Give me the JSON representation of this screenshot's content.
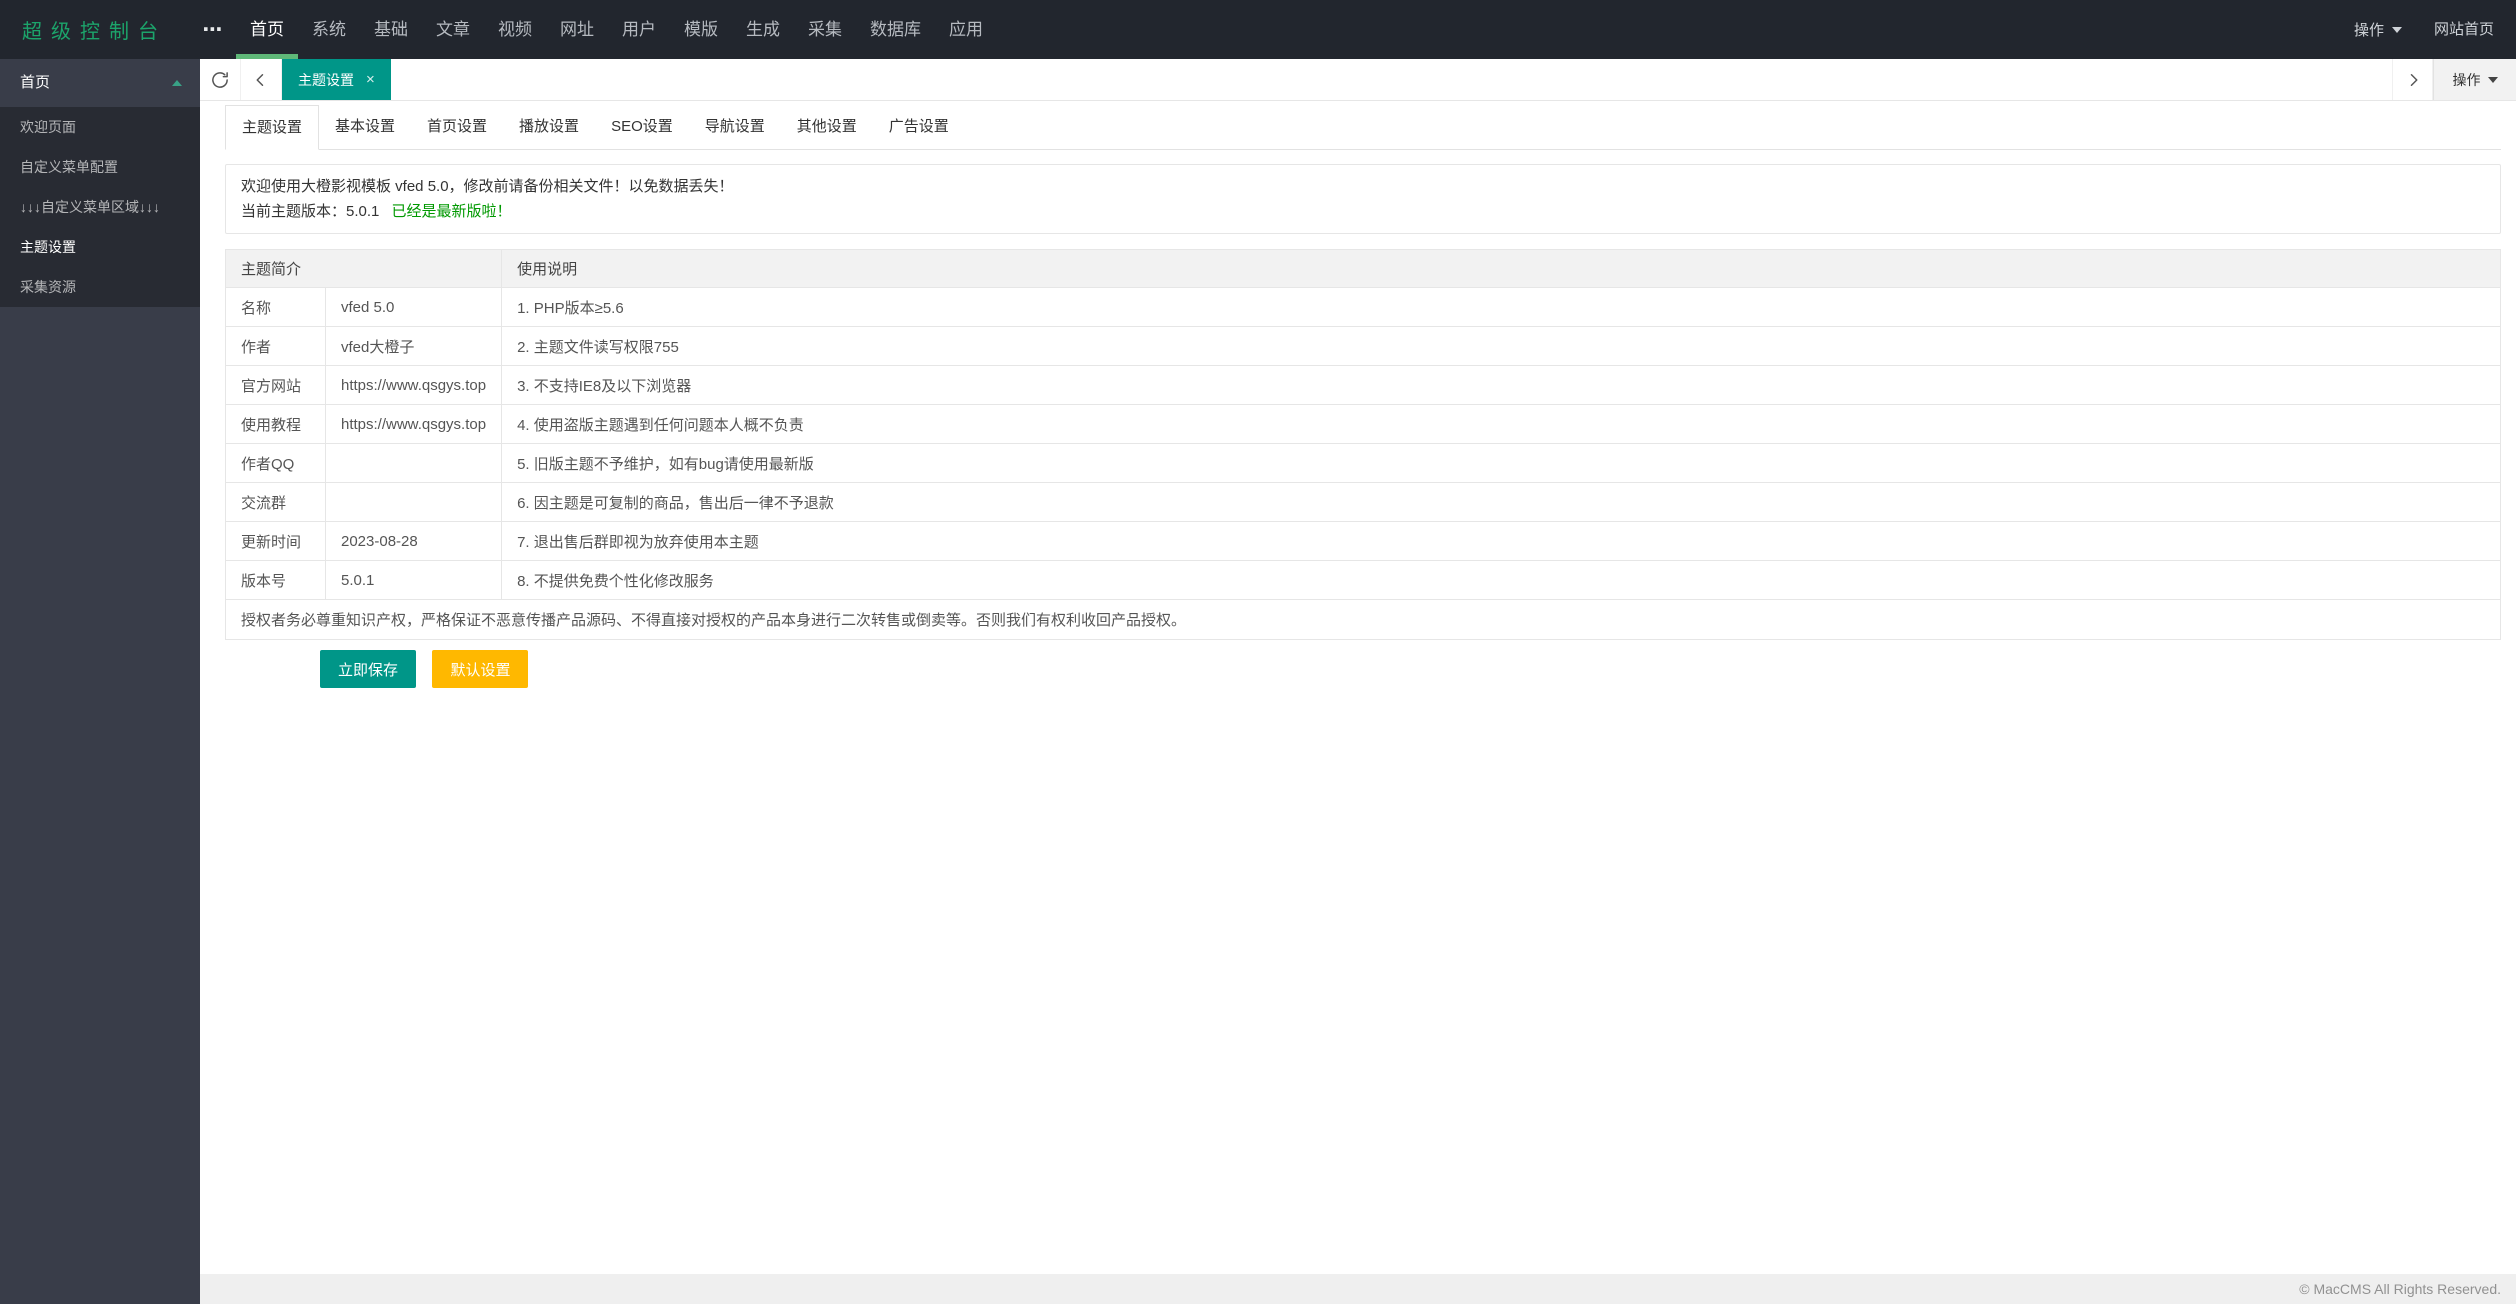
{
  "topbar": {
    "logo": "超级控制台",
    "ellipsis": "⋯",
    "nav": [
      "首页",
      "系统",
      "基础",
      "文章",
      "视频",
      "网址",
      "用户",
      "模版",
      "生成",
      "采集",
      "数据库",
      "应用"
    ],
    "active_nav_index": 0,
    "action_label": "操作",
    "site_home_label": "网站首页"
  },
  "sidebar": {
    "group_label": "首页",
    "items": [
      {
        "label": "欢迎页面",
        "active": false
      },
      {
        "label": "自定义菜单配置",
        "active": false
      },
      {
        "label": "↓↓↓自定义菜单区域↓↓↓",
        "active": false
      },
      {
        "label": "主题设置",
        "active": true
      },
      {
        "label": "采集资源",
        "active": false
      }
    ]
  },
  "tabbar": {
    "active_tab": "主题设置",
    "close_glyph": "×",
    "action_label": "操作"
  },
  "content": {
    "tabs": [
      "主题设置",
      "基本设置",
      "首页设置",
      "播放设置",
      "SEO设置",
      "导航设置",
      "其他设置",
      "广告设置"
    ],
    "active_tab_index": 0,
    "notice": {
      "line1": "欢迎使用大橙影视模板 vfed 5.0，修改前请备份相关文件！以免数据丢失！",
      "line2_prefix": "当前主题版本：5.0.1",
      "line2_highlight": "已经是最新版啦！"
    },
    "table": {
      "headers": [
        "主题简介",
        "使用说明"
      ],
      "rows": [
        {
          "label": "名称",
          "value": "vfed 5.0",
          "note": "1. PHP版本≥5.6"
        },
        {
          "label": "作者",
          "value": "vfed大橙子",
          "note": "2. 主题文件读写权限755"
        },
        {
          "label": "官方网站",
          "value": "https://www.qsgys.top",
          "note": "3. 不支持IE8及以下浏览器"
        },
        {
          "label": "使用教程",
          "value": "https://www.qsgys.top",
          "note": "4. 使用盗版主题遇到任何问题本人概不负责"
        },
        {
          "label": "作者QQ",
          "value": "",
          "note": "5. 旧版主题不予维护，如有bug请使用最新版"
        },
        {
          "label": "交流群",
          "value": "",
          "note": "6. 因主题是可复制的商品，售出后一律不予退款"
        },
        {
          "label": "更新时间",
          "value": "2023-08-28",
          "note": "7. 退出售后群即视为放弃使用本主题"
        },
        {
          "label": "版本号",
          "value": "5.0.1",
          "note": "8. 不提供免费个性化修改服务"
        }
      ],
      "footer_note": "授权者务必尊重知识产权，严格保证不恶意传播产品源码、不得直接对授权的产品本身进行二次转售或倒卖等。否则我们有权利收回产品授权。"
    },
    "buttons": {
      "save": "立即保存",
      "default": "默认设置"
    }
  },
  "footer": {
    "copyright": "© MacCMS All Rights Reserved."
  },
  "colors": {
    "accent_teal": "#009688",
    "warn_orange": "#FFB800",
    "nav_underline_green": "#5FB878",
    "success_text_green": "#009900",
    "logo_green": "#1ca46b",
    "topbar_bg": "#22262e",
    "sidebar_bg": "#393d49",
    "submenu_bg": "#282b33"
  }
}
